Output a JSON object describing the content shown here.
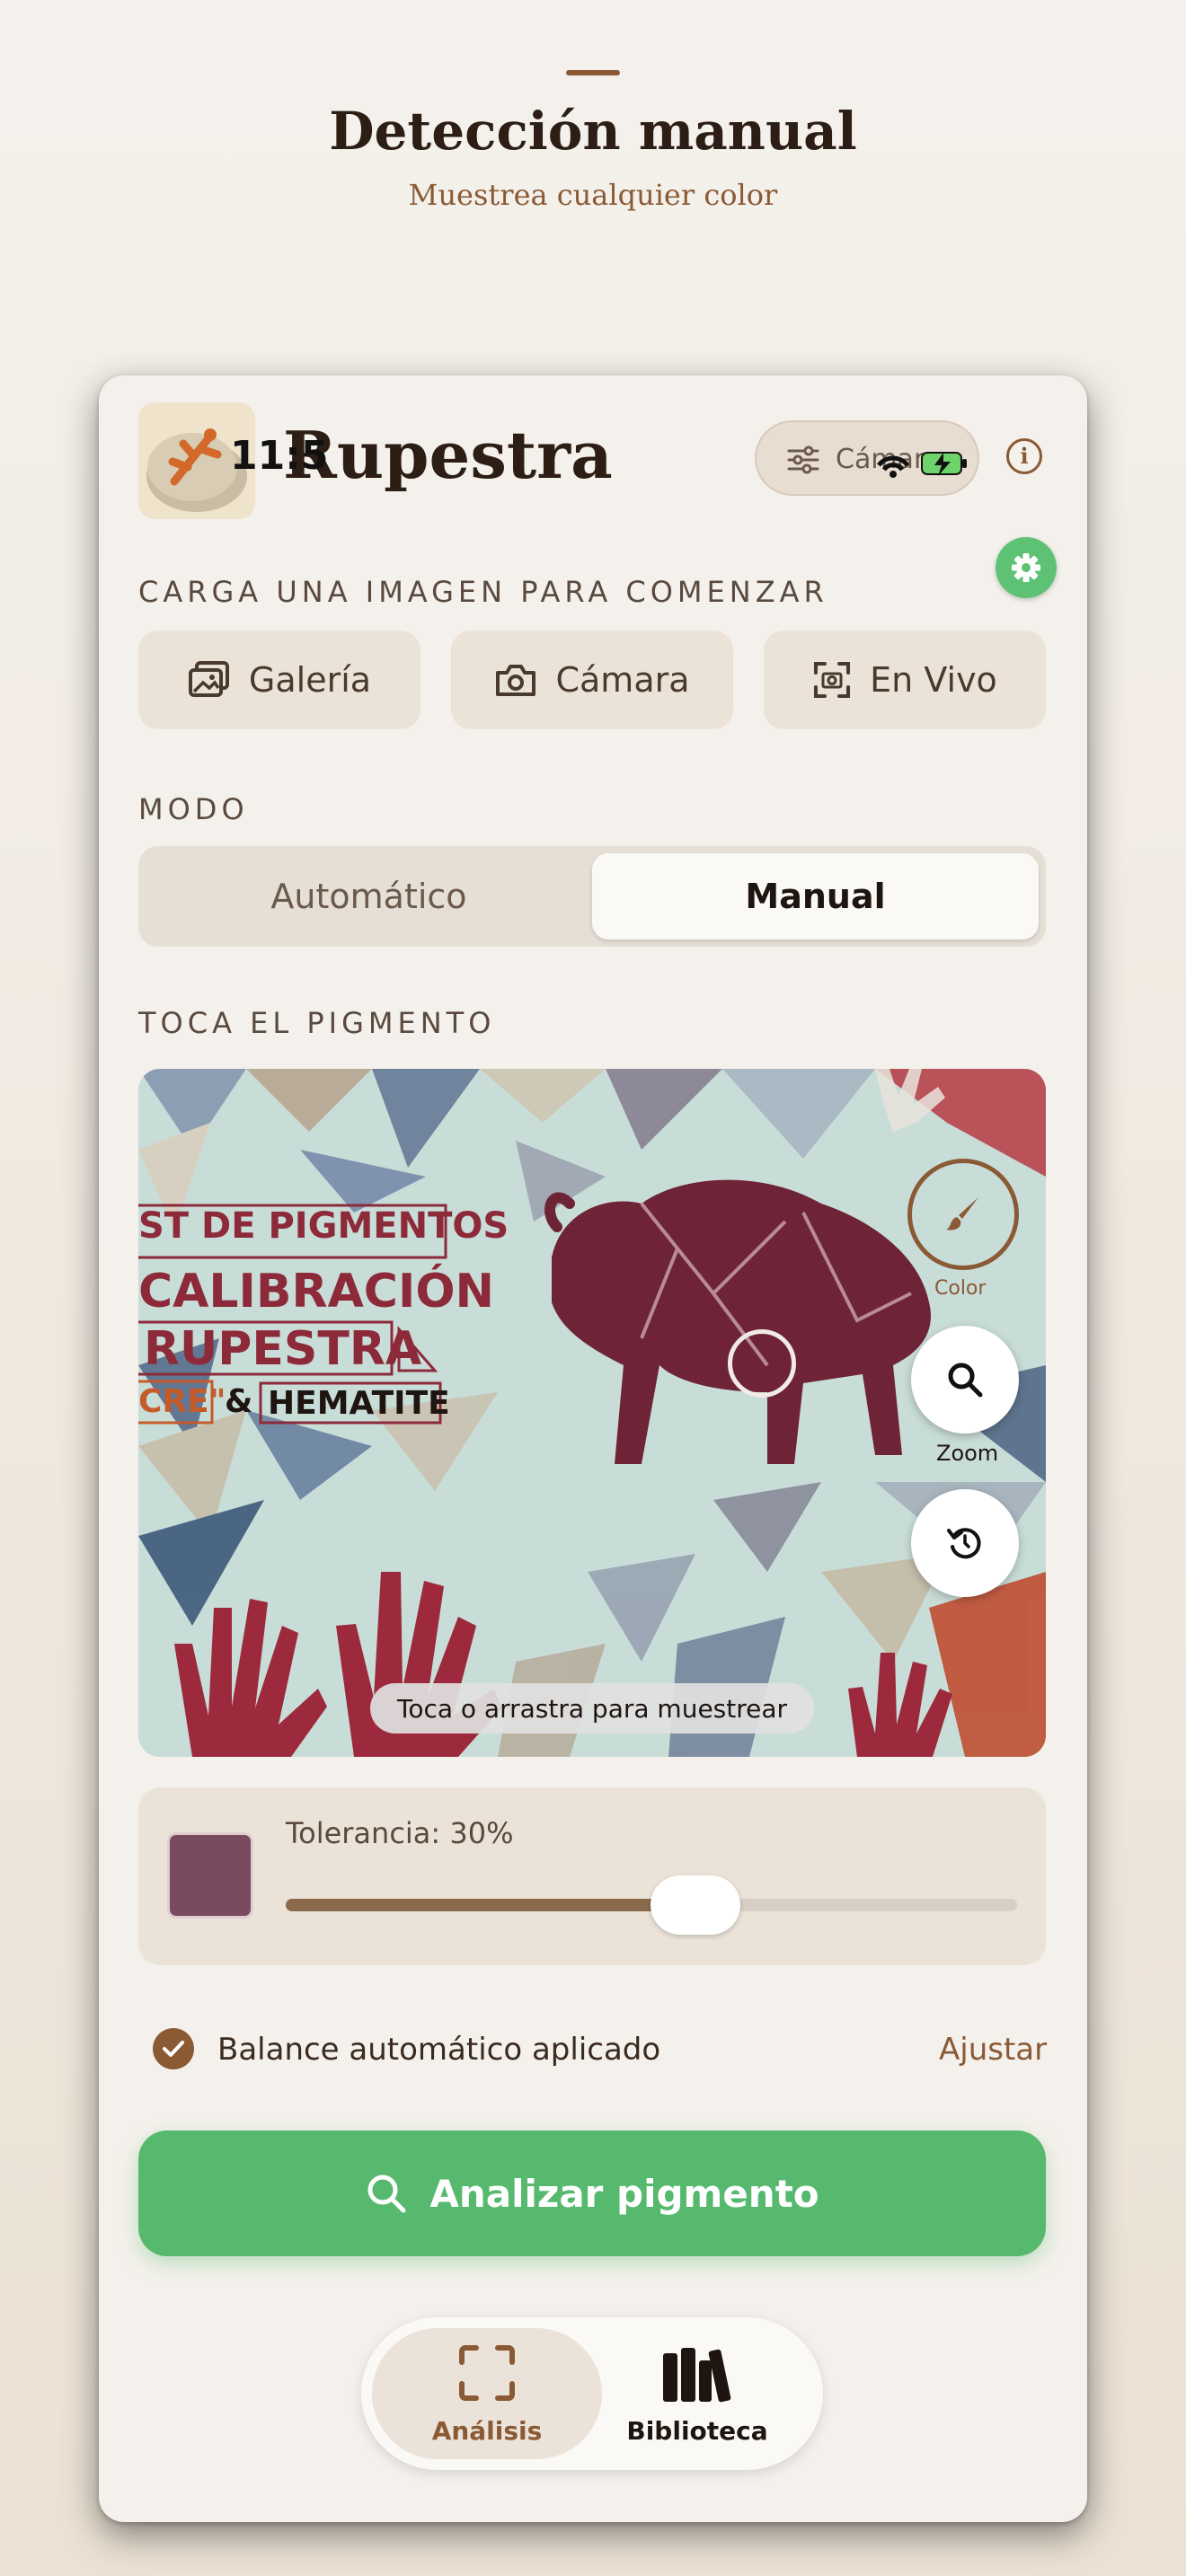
{
  "hero": {
    "title": "Detección manual",
    "subtitle": "Muestrea cualquier color"
  },
  "status": {
    "time": "11:5"
  },
  "header": {
    "app_title": "Rupestra",
    "camera_pill_label": "Cámara",
    "info_icon": "info-icon",
    "settings_icon": "gear-icon"
  },
  "upload": {
    "section_label": "CARGA UNA IMAGEN PARA COMENZAR",
    "buttons": [
      {
        "label": "Galería",
        "icon": "gallery-icon"
      },
      {
        "label": "Cámara",
        "icon": "camera-icon"
      },
      {
        "label": "En Vivo",
        "icon": "live-camera-icon"
      }
    ]
  },
  "mode": {
    "section_label": "MODO",
    "options": [
      "Automático",
      "Manual"
    ],
    "selected": "Manual"
  },
  "pigment": {
    "section_label": "TOCA EL PIGMENTO",
    "image_text": [
      "ST DE PIGMENTOS",
      "CALIBRACIÓN",
      "RUPESTRA",
      "CRE\"",
      "&",
      "HEMATITE"
    ],
    "color_ring_label": "Color",
    "zoom_label": "Zoom",
    "hint": "Toca o arrastra para muestrear"
  },
  "tolerance": {
    "label": "Tolerancia: 30%",
    "value_fraction": 0.56,
    "swatch_color": "#7a4a5e"
  },
  "balance": {
    "text": "Balance automático aplicado",
    "adjust_label": "Ajustar"
  },
  "analyze": {
    "label": "Analizar pigmento"
  },
  "tabs": [
    {
      "label": "Análisis",
      "icon": "scan-icon",
      "active": true
    },
    {
      "label": "Biblioteca",
      "icon": "library-icon",
      "active": false
    }
  ],
  "colors": {
    "accent": "#8a5a35",
    "primary_green": "#56b96e",
    "background": "#f4f1ec"
  }
}
